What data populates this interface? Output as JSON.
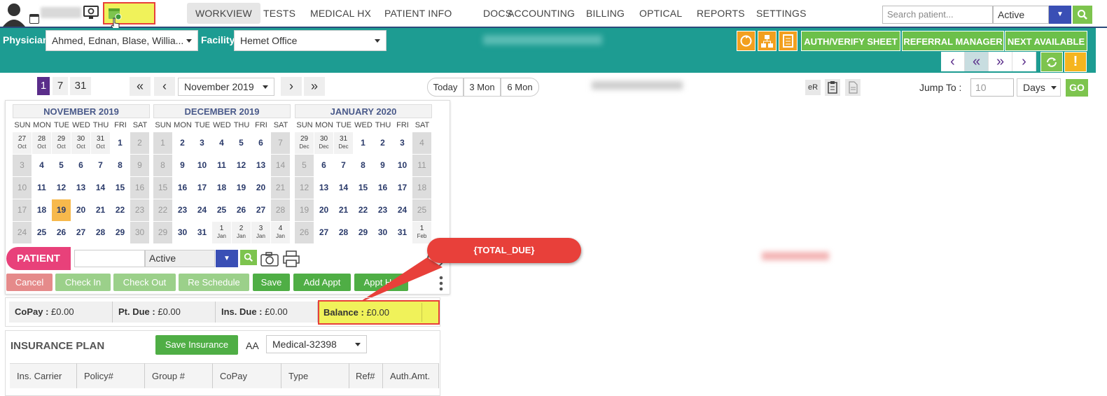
{
  "topbar": {
    "nav": [
      "WORKVIEW",
      "TESTS",
      "MEDICAL HX",
      "PATIENT INFO",
      "DOCS",
      "ACCOUNTING",
      "BILLING",
      "OPTICAL",
      "REPORTS",
      "SETTINGS"
    ],
    "active_nav": "WORKVIEW",
    "search_placeholder": "Search patient...",
    "status_value": "Active"
  },
  "filterbar": {
    "physician_label": "Physician",
    "physician_value": "Ahmed, Ednan, Blase, Willia...",
    "facility_label": "Facility",
    "facility_value": "Hemet Office",
    "buttons": [
      "AUTH/VERIFY SHEET",
      "REFERRAL MANAGER",
      "NEXT AVAILABLE"
    ]
  },
  "daterow": {
    "day_views": [
      "1",
      "7",
      "31"
    ],
    "month_value": "November 2019",
    "quick": [
      "Today",
      "3 Mon",
      "6 Mon"
    ],
    "er_label": "eR",
    "jump_label": "Jump To :",
    "jump_value": "10",
    "jump_unit": "Days",
    "go_label": "GO"
  },
  "calendars": [
    {
      "title": "NOVEMBER 2019",
      "weeks": [
        [
          {
            "d": "27",
            "m": "Oct",
            "t": "other"
          },
          {
            "d": "28",
            "m": "Oct",
            "t": "other"
          },
          {
            "d": "29",
            "m": "Oct",
            "t": "other"
          },
          {
            "d": "30",
            "m": "Oct",
            "t": "other"
          },
          {
            "d": "31",
            "m": "Oct",
            "t": "other"
          },
          {
            "d": "1"
          },
          {
            "d": "2",
            "t": "wk"
          }
        ],
        [
          {
            "d": "3",
            "t": "wk"
          },
          {
            "d": "4"
          },
          {
            "d": "5"
          },
          {
            "d": "6"
          },
          {
            "d": "7"
          },
          {
            "d": "8"
          },
          {
            "d": "9",
            "t": "wk"
          }
        ],
        [
          {
            "d": "10",
            "t": "wk"
          },
          {
            "d": "11"
          },
          {
            "d": "12"
          },
          {
            "d": "13"
          },
          {
            "d": "14"
          },
          {
            "d": "15"
          },
          {
            "d": "16",
            "t": "wk"
          }
        ],
        [
          {
            "d": "17",
            "t": "wk"
          },
          {
            "d": "18"
          },
          {
            "d": "19",
            "t": "today"
          },
          {
            "d": "20"
          },
          {
            "d": "21"
          },
          {
            "d": "22"
          },
          {
            "d": "23",
            "t": "wk"
          }
        ],
        [
          {
            "d": "24",
            "t": "wk"
          },
          {
            "d": "25"
          },
          {
            "d": "26"
          },
          {
            "d": "27"
          },
          {
            "d": "28"
          },
          {
            "d": "29"
          },
          {
            "d": "30",
            "t": "wk"
          }
        ]
      ]
    },
    {
      "title": "DECEMBER 2019",
      "weeks": [
        [
          {
            "d": "1",
            "t": "wk"
          },
          {
            "d": "2"
          },
          {
            "d": "3"
          },
          {
            "d": "4"
          },
          {
            "d": "5"
          },
          {
            "d": "6"
          },
          {
            "d": "7",
            "t": "wk"
          }
        ],
        [
          {
            "d": "8",
            "t": "wk"
          },
          {
            "d": "9"
          },
          {
            "d": "10"
          },
          {
            "d": "11"
          },
          {
            "d": "12"
          },
          {
            "d": "13"
          },
          {
            "d": "14",
            "t": "wk"
          }
        ],
        [
          {
            "d": "15",
            "t": "wk"
          },
          {
            "d": "16"
          },
          {
            "d": "17"
          },
          {
            "d": "18"
          },
          {
            "d": "19"
          },
          {
            "d": "20"
          },
          {
            "d": "21",
            "t": "wk"
          }
        ],
        [
          {
            "d": "22",
            "t": "wk"
          },
          {
            "d": "23"
          },
          {
            "d": "24"
          },
          {
            "d": "25"
          },
          {
            "d": "26"
          },
          {
            "d": "27"
          },
          {
            "d": "28",
            "t": "wk"
          }
        ],
        [
          {
            "d": "29",
            "t": "wk"
          },
          {
            "d": "30"
          },
          {
            "d": "31"
          },
          {
            "d": "1",
            "m": "Jan",
            "t": "other"
          },
          {
            "d": "2",
            "m": "Jan",
            "t": "other"
          },
          {
            "d": "3",
            "m": "Jan",
            "t": "other"
          },
          {
            "d": "4",
            "m": "Jan",
            "t": "other"
          }
        ]
      ]
    },
    {
      "title": "JANUARY 2020",
      "weeks": [
        [
          {
            "d": "29",
            "m": "Dec",
            "t": "other"
          },
          {
            "d": "30",
            "m": "Dec",
            "t": "other"
          },
          {
            "d": "31",
            "m": "Dec",
            "t": "other"
          },
          {
            "d": "1"
          },
          {
            "d": "2"
          },
          {
            "d": "3"
          },
          {
            "d": "4",
            "t": "wk"
          }
        ],
        [
          {
            "d": "5",
            "t": "wk"
          },
          {
            "d": "6"
          },
          {
            "d": "7"
          },
          {
            "d": "8"
          },
          {
            "d": "9"
          },
          {
            "d": "10"
          },
          {
            "d": "11",
            "t": "wk"
          }
        ],
        [
          {
            "d": "12",
            "t": "wk"
          },
          {
            "d": "13"
          },
          {
            "d": "14"
          },
          {
            "d": "15"
          },
          {
            "d": "16"
          },
          {
            "d": "17"
          },
          {
            "d": "18",
            "t": "wk"
          }
        ],
        [
          {
            "d": "19",
            "t": "wk"
          },
          {
            "d": "20"
          },
          {
            "d": "21"
          },
          {
            "d": "22"
          },
          {
            "d": "23"
          },
          {
            "d": "24"
          },
          {
            "d": "25",
            "t": "wk"
          }
        ],
        [
          {
            "d": "26",
            "t": "wk"
          },
          {
            "d": "27"
          },
          {
            "d": "28"
          },
          {
            "d": "29"
          },
          {
            "d": "30"
          },
          {
            "d": "31"
          },
          {
            "d": "1",
            "m": "Feb",
            "t": "other"
          }
        ]
      ]
    }
  ],
  "weekdays": [
    "SUN",
    "MON",
    "TUE",
    "WED",
    "THU",
    "FRI",
    "SAT"
  ],
  "patient": {
    "label": "PATIENT",
    "status": "Active",
    "actions": [
      "Cancel",
      "Check In",
      "Check Out",
      "Re Schedule",
      "Save",
      "Add Appt",
      "Appt Hx."
    ]
  },
  "callout": "{TOTAL_DUE}",
  "financial": {
    "copay_label": "CoPay :",
    "copay_value": "£0.00",
    "ptdue_label": "Pt. Due :",
    "ptdue_value": "£0.00",
    "insdue_label": "Ins. Due :",
    "insdue_value": "£0.00",
    "balance_label": "Balance :",
    "balance_value": "£0.00"
  },
  "insurance": {
    "title": "INSURANCE PLAN",
    "save_label": "Save Insurance",
    "aa_label": "AA",
    "plan_value": "Medical-32398",
    "columns": [
      "Ins. Carrier",
      "Policy#",
      "Group #",
      "CoPay",
      "Type",
      "Ref#",
      "Auth.Amt."
    ]
  },
  "colors": {
    "teal": "#1d9c92",
    "green": "#6cc04a",
    "pink": "#e8417a",
    "highlight": "#f0f25a",
    "callout": "#e8403a"
  }
}
